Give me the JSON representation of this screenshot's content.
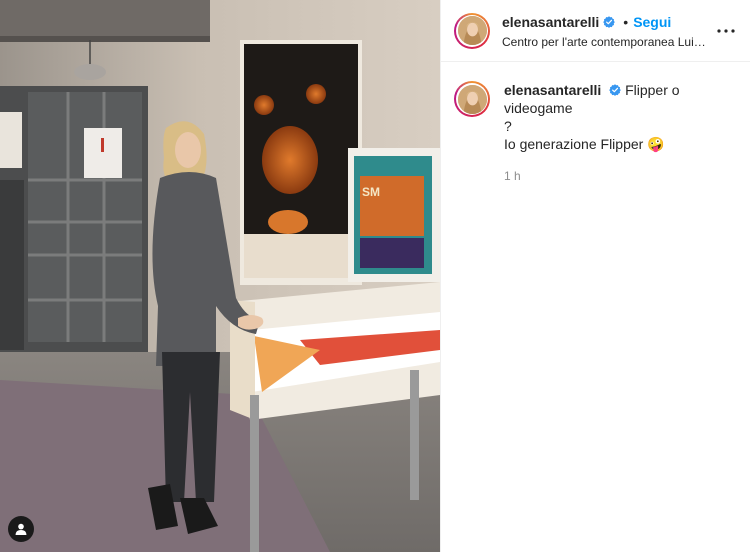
{
  "post": {
    "photo": {
      "alt_icon": "user-tag-icon"
    }
  },
  "header": {
    "username": "elenasantarelli",
    "separator": "•",
    "follow_label": "Segui",
    "location": "Centro per l'arte contemporanea Luigi Pecci",
    "more_icon": "more-horizontal-icon",
    "verified_icon": "verified-badge-icon"
  },
  "caption": {
    "username": "elenasantarelli",
    "line1": "Flipper o videogame",
    "line2": "?",
    "line3": "Io generazione Flipper 🤪",
    "timestamp": "1 h"
  },
  "colors": {
    "follow": "#0095f6",
    "verified": "#3897f0",
    "text": "#262626",
    "muted": "#8e8e8e"
  }
}
